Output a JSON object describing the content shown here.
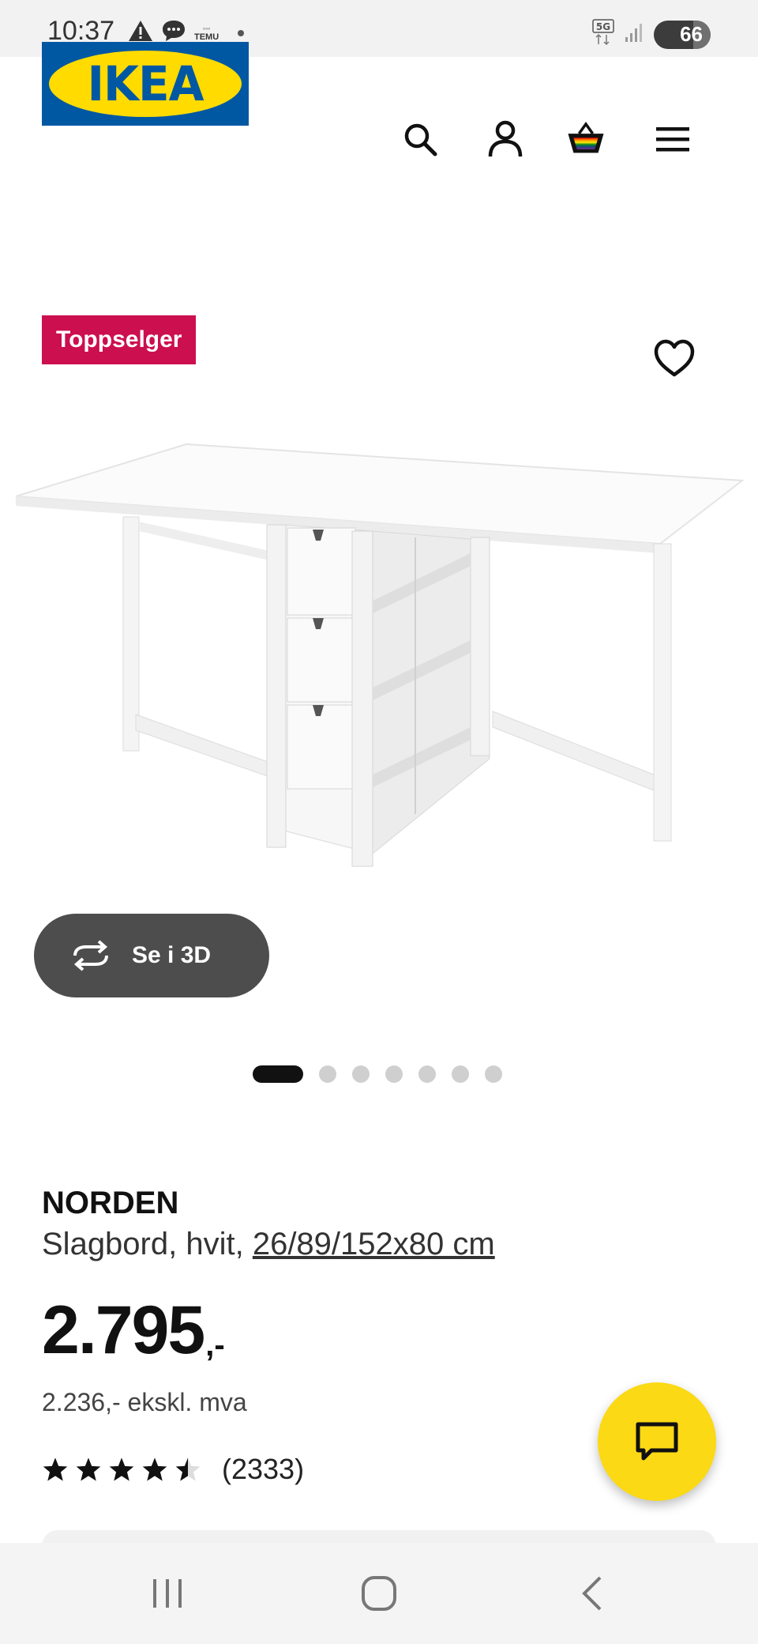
{
  "status_bar": {
    "time": "10:37",
    "temu_text": "TEMU",
    "network": "5G",
    "battery": "66"
  },
  "header": {
    "logo_text": "IKEA",
    "icons": [
      "search-icon",
      "account-icon",
      "shopping-bag-icon",
      "menu-icon"
    ]
  },
  "product": {
    "badge": "Toppselger",
    "name": "NORDEN",
    "description": "Slagbord, hvit, ",
    "dimensions": "26/89/152x80 cm",
    "price_main": "2.795",
    "price_suffix": ",-",
    "price_ex_vat": "2.236,- ekskl. mva",
    "rating": 4.5,
    "review_count": "(2333)",
    "view_3d_label": "Se i 3D",
    "image_count": 7,
    "active_image": 1
  },
  "colors": {
    "ikea_blue": "#0058a3",
    "ikea_yellow": "#ffdb00",
    "badge_red": "#cc0f4e",
    "chat_yellow": "#fbd914",
    "btn_dark": "#4d4d4d"
  }
}
